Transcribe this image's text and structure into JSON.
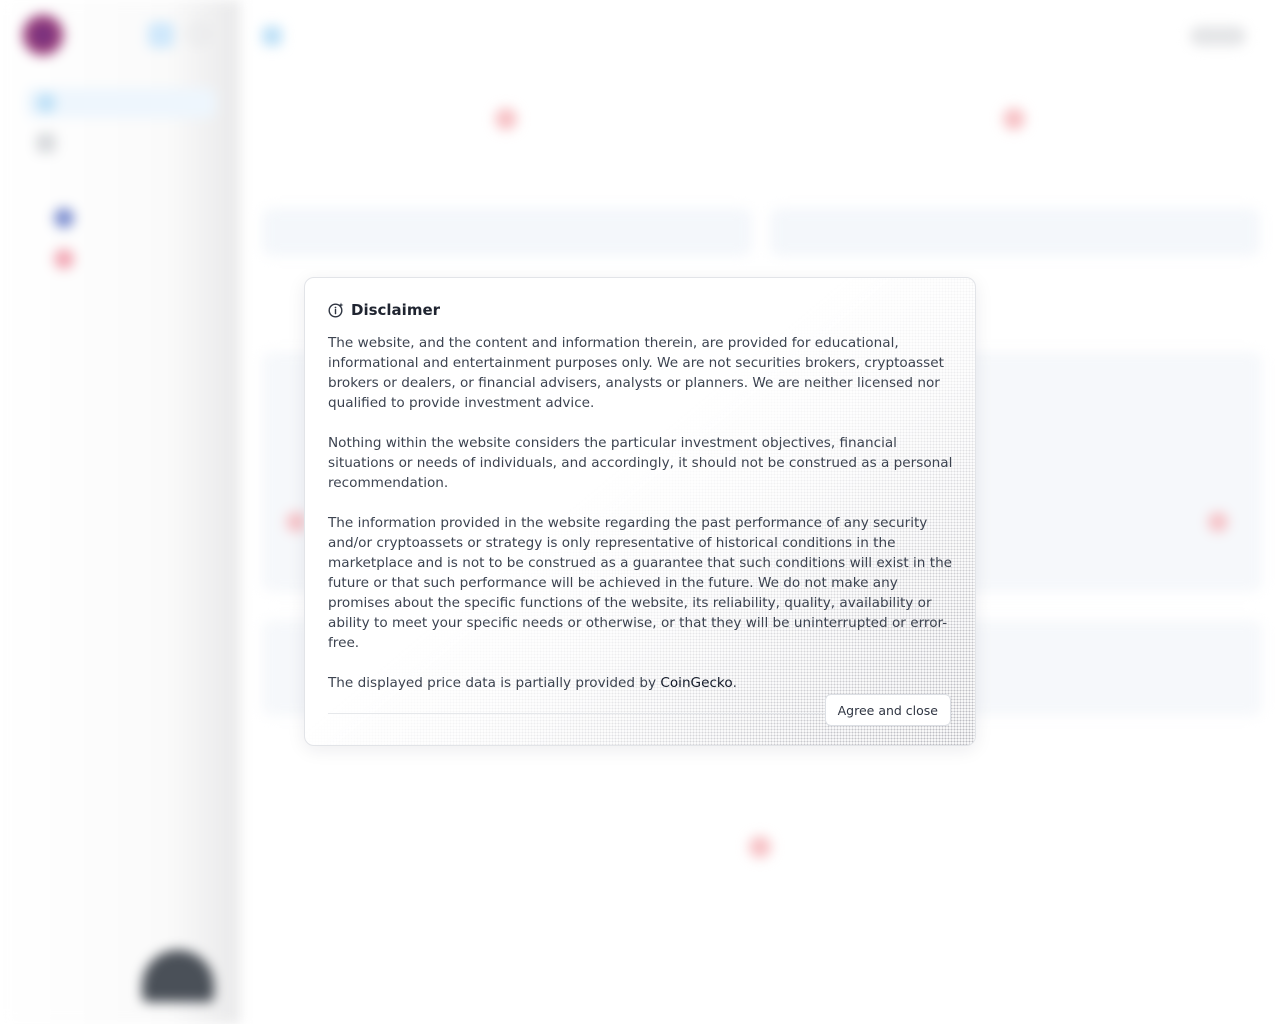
{
  "modal": {
    "title": "Disclaimer",
    "paragraphs": [
      "The website, and the content and information therein, are provided for educational, informational and entertainment purposes only. We are not securities brokers, cryptoasset brokers or dealers, or financial advisers, analysts or planners. We are neither licensed nor qualified to provide investment advice.",
      "Nothing within the website considers the particular investment objectives, financial situations or needs of individuals, and accordingly, it should not be construed as a personal recommendation.",
      "The information provided in the website regarding the past performance of any security and/or cryptoassets or strategy is only representative of historical conditions in the marketplace and is not to be construed as a guarantee that such conditions will exist in the future or that such performance will be achieved in the future. We do not make any promises about the specific functions of the website, its reliability, quality, availability or ability to meet your specific needs or otherwise, or that they will be uninterrupted or error-free."
    ],
    "price_note_prefix": "The displayed price data is partially provided by ",
    "price_note_link": "CoinGecko",
    "price_note_suffix": ".",
    "agree_label": "Agree and close"
  },
  "colors": {
    "error_tint": "#f7c1c5",
    "accent_blue": "#bfe1f7"
  }
}
